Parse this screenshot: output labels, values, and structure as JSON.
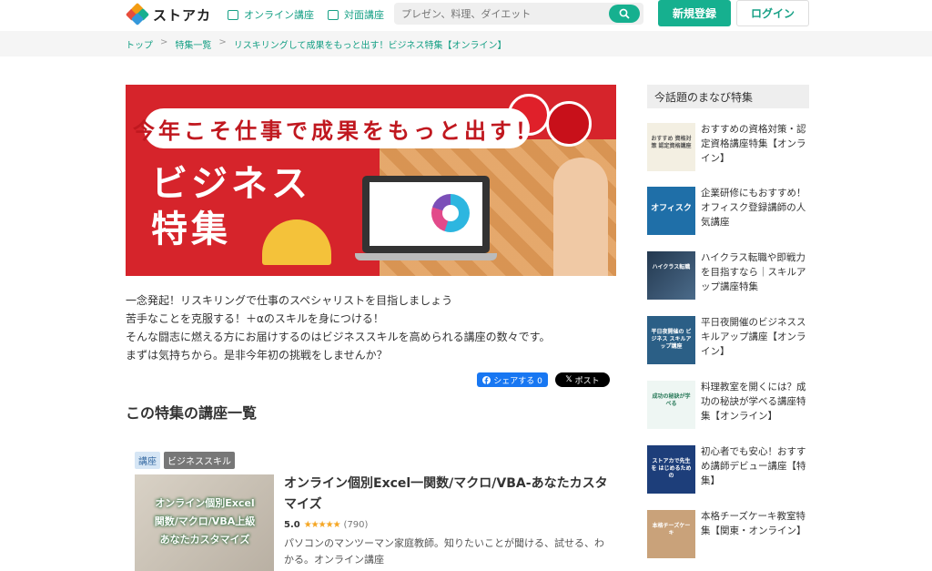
{
  "header": {
    "logo_text": "ストアカ",
    "nav_online": "オンライン講座",
    "nav_offline": "対面講座",
    "search_placeholder": "プレゼン、料理、ダイエット",
    "signup": "新規登録",
    "login": "ログイン"
  },
  "breadcrumb": {
    "items": [
      "トップ",
      "特集一覧",
      "リスキリングして成果をもっと出す！ビジネス特集【オンライン】"
    ],
    "separator": ">"
  },
  "banner": {
    "headline": "今年こそ仕事で成果をもっと出す！",
    "title_line1": "ビジネス",
    "title_line2": "特集"
  },
  "intro": {
    "lines": [
      "一念発起！リスキリングで仕事のスペシャリストを目指しましょう",
      "苦手なことを克服する！＋αのスキルを身につける！",
      "そんな闘志に燃える方にお届けするのはビジネススキルを高められる講座の数々です。",
      "まずは気持ちから。是非今年初の挑戦をしませんか？"
    ]
  },
  "share": {
    "facebook": "シェアする 0",
    "x": "ポスト"
  },
  "section_title": "この特集の講座一覧",
  "course": {
    "tags": [
      "講座",
      "ビジネススキル"
    ],
    "image_text": [
      "オンライン個別Excel",
      "関数/マクロ/VBA上級",
      "あなたカスタマイズ"
    ],
    "title": "オンライン個別Excel一関数/マクロ/VBA-あなたカスタマイズ",
    "rating": "5.0",
    "stars": "★★★★★",
    "review_count": "(790)",
    "description": "パソコンのマンツーマン家庭教師。知りたいことが聞ける、試せる、わかる。オンライン講座"
  },
  "sidebar": {
    "heading": "今話題のまなび特集",
    "items": [
      {
        "text": "おすすめの資格対策・認定資格講座特集【オンライン】",
        "thumb_label": "おすすめ 資格対策 認定資格講座",
        "thumb_color": "#f3efe2"
      },
      {
        "text": "企業研修にもおすすめ！オフィスク登録講師の人気講座",
        "thumb_label": "オフィスク",
        "thumb_color": "#1f6fa8"
      },
      {
        "text": "ハイクラス転職や即戦力を目指すなら｜スキルアップ講座特集",
        "thumb_label": "ハイクラス転職",
        "thumb_color": "#23384f"
      },
      {
        "text": "平日夜開催のビジネススキルアップ講座【オンライン】",
        "thumb_label": "平日夜開催の ビジネス スキルアップ講座",
        "thumb_color": "#2b5f86"
      },
      {
        "text": "料理教室を開くには？成功の秘訣が学べる講座特集【オンライン】",
        "thumb_label": "成功の秘訣が学べる",
        "thumb_color": "#eef6f3"
      },
      {
        "text": "初心者でも安心！おすすめ講師デビュー講座【特集】",
        "thumb_label": "ストアカで先生を はじめるための",
        "thumb_color": "#1d3e7a"
      },
      {
        "text": "本格チーズケーキ教室特集【関東・オンライン】",
        "thumb_label": "本格チーズケーキ",
        "thumb_color": "#c9a27a"
      }
    ]
  },
  "colors": {
    "accent": "#16b08f",
    "banner_red": "#d6242b"
  }
}
